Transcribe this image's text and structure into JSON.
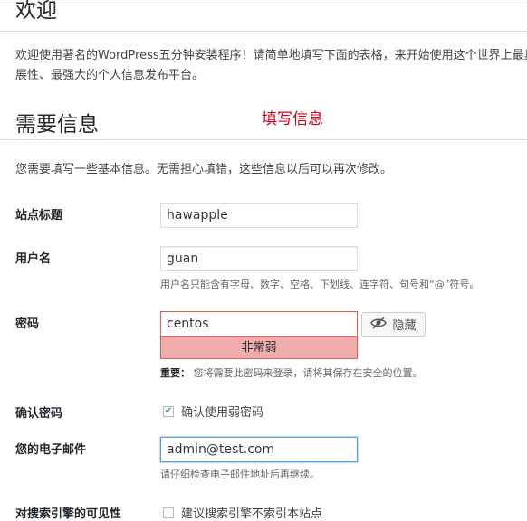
{
  "header": {
    "welcome_title": "欢迎",
    "intro_text": "欢迎使用著名的WordPress五分钟安装程序！请简单地填写下面的表格，来开始使用这个世界上最具扩展性、最强大的个人信息发布平台。"
  },
  "section": {
    "title": "需要信息",
    "annotation": "填写信息",
    "sub_intro": "您需要填写一些基本信息。无需担心填错，这些信息以后可以再次修改。"
  },
  "form": {
    "site_title": {
      "label": "站点标题",
      "value": "hawapple"
    },
    "username": {
      "label": "用户名",
      "value": "guan",
      "hint": "用户名只能含有字母、数字、空格、下划线、连字符、句号和“@”符号。"
    },
    "password": {
      "label": "密码",
      "value": "centos",
      "strength": "非常弱",
      "hide_label": "隐藏",
      "note_strong": "重要：",
      "note_text": "您将需要此密码来登录，请将其保存在安全的位置。"
    },
    "confirm_password": {
      "label": "确认密码",
      "checkbox_label": "确认使用弱密码",
      "checked": true
    },
    "email": {
      "label": "您的电子邮件",
      "value": "admin@test.com",
      "hint": "请仔细检查电子邮件地址后再继续。"
    },
    "search_visibility": {
      "label": "对搜索引擎的可见性",
      "checkbox_label": "建议搜索引擎不索引本站点",
      "checked": false
    }
  },
  "colors": {
    "annotation": "#d0021b",
    "weak_bg": "#f1adad",
    "weak_border": "#e35b5b",
    "focus_border": "#5b9dd9"
  },
  "icons": {
    "hide": "eye-slash-icon",
    "check": "checkmark-icon"
  }
}
